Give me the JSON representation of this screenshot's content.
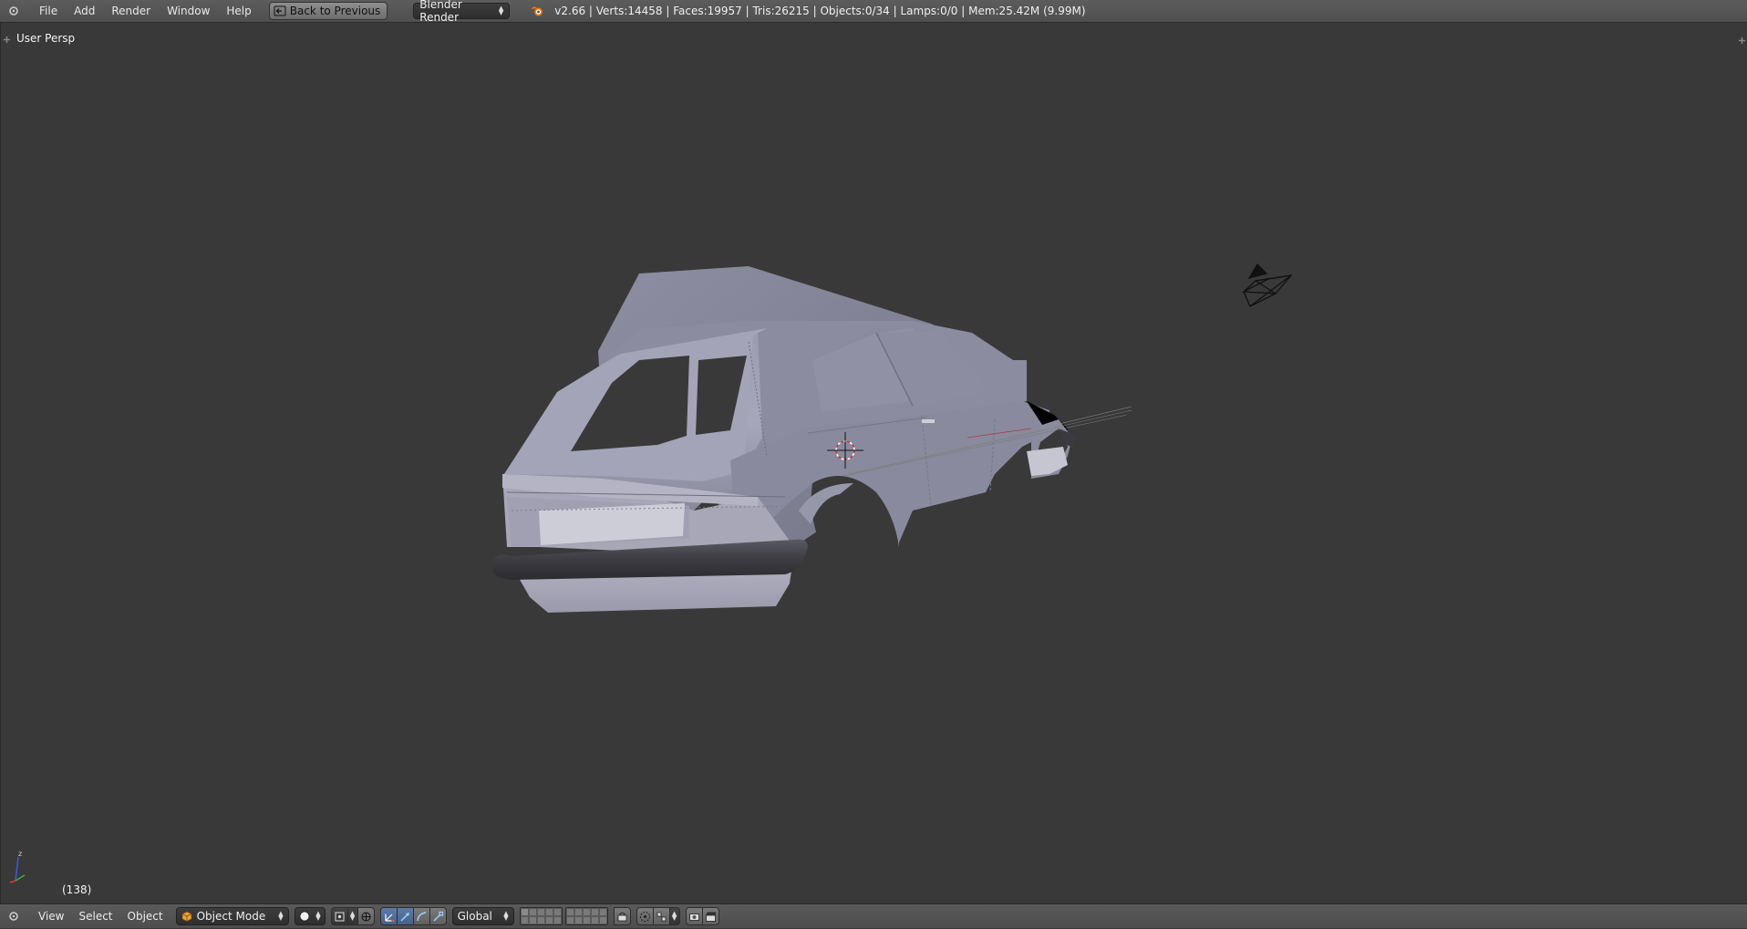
{
  "top_header": {
    "editor_icon": "info-editor-icon",
    "menus": [
      "File",
      "Add",
      "Render",
      "Window",
      "Help"
    ],
    "back_button": "Back to Previous",
    "render_engine": "Blender Render",
    "stats": "v2.66 | Verts:14458 | Faces:19957 | Tris:26215 | Objects:0/34 | Lamps:0/0 | Mem:25.42M (9.99M)"
  },
  "viewport": {
    "view_label": "User Persp",
    "frame_label": "(138)",
    "objects": [
      "car-body-mesh",
      "camera-object",
      "3d-cursor"
    ],
    "axis_labels": {
      "z": "z"
    }
  },
  "bottom_header": {
    "editor_icon": "3d-view-editor-icon",
    "menus": [
      "View",
      "Select",
      "Object"
    ],
    "mode": "Object Mode",
    "transform_orientation": "Global",
    "colors": {
      "accent_active": "#5f7ca6",
      "header": "#555555",
      "viewport_bg": "#393939"
    }
  }
}
